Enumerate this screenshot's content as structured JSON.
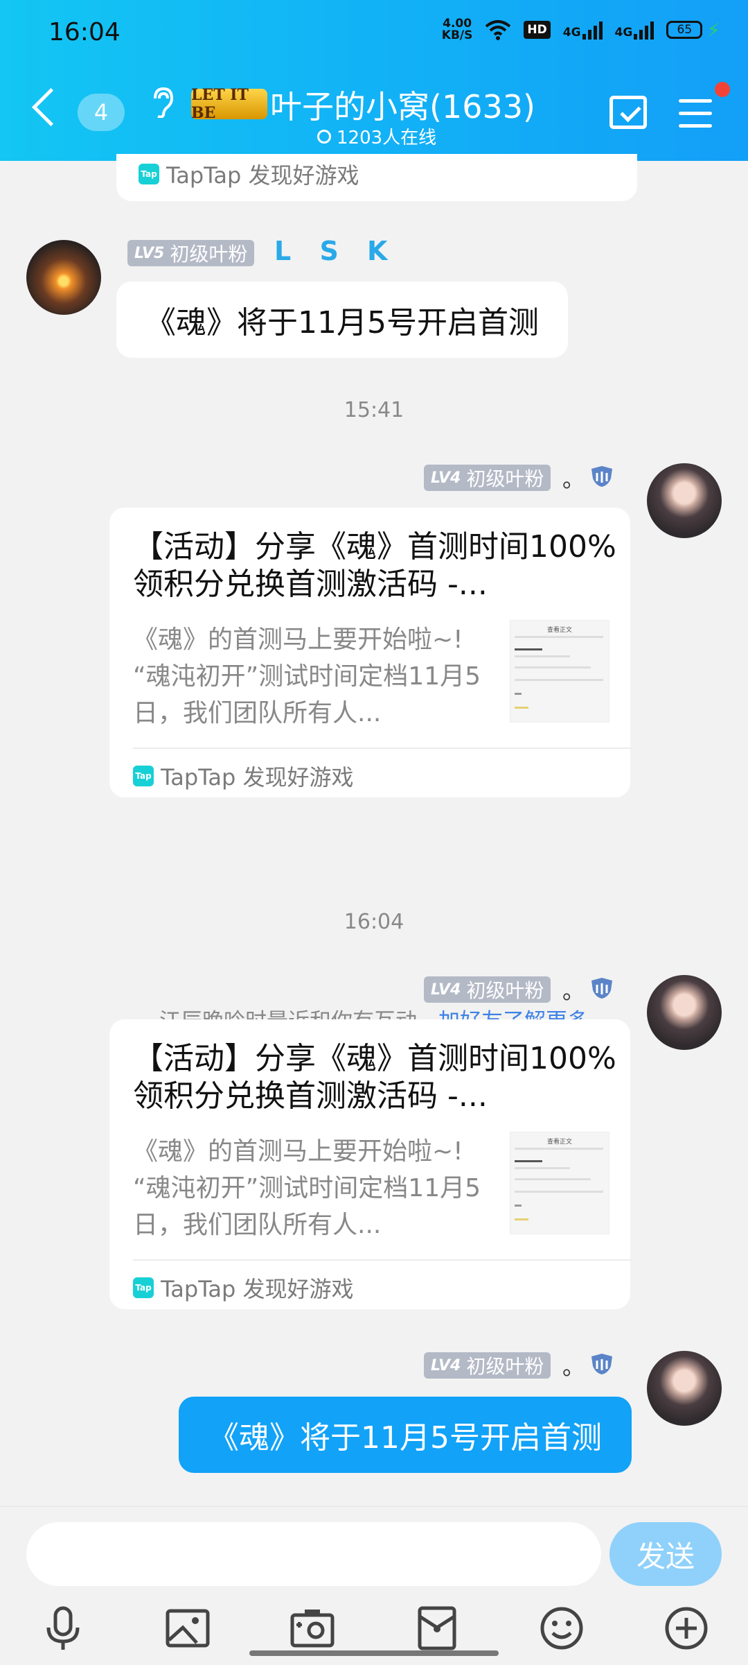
{
  "status_bar": {
    "time": "16:04",
    "net_speed_value": "4.00",
    "net_speed_unit": "KB/S",
    "hd_label": "HD",
    "sig1": "4G",
    "sig2": "4G",
    "battery": "65"
  },
  "header": {
    "unread_count": "4",
    "logo_text": "LET IT BE",
    "title": "叶子的小窝(1633)",
    "online": "1203人在线"
  },
  "messages": {
    "top_partial_source": "TapTap 发现好游戏",
    "msg1": {
      "level_badge": "LV5",
      "level_title": "初级叶粉",
      "username": "L S K",
      "text": "《魂》将于11月5号开启首测"
    },
    "time1": "15:41",
    "msg2": {
      "level_badge": "LV4",
      "level_title": "初级叶粉",
      "suffix": "。",
      "card_title": "【活动】分享《魂》首测时间100%领积分兑换首测激活码 -...",
      "card_body": "《魂》的首测马上要开始啦~! “魂沌初开”测试时间定档11月5日，我们团队所有人...",
      "thumb_title": "查看正文",
      "source": "TapTap 发现好游戏"
    },
    "notice_text": "江辰晚吟时最近和你有互动，",
    "notice_link": "加好友了解更多",
    "time2": "16:04",
    "msg3": {
      "level_badge": "LV4",
      "level_title": "初级叶粉",
      "suffix": "。",
      "card_title": "【活动】分享《魂》首测时间100%领积分兑换首测激活码 -...",
      "card_body": "《魂》的首测马上要开始啦~! “魂沌初开”测试时间定档11月5日，我们团队所有人...",
      "thumb_title": "查看正文",
      "source": "TapTap 发现好游戏"
    },
    "msg4": {
      "level_badge": "LV4",
      "level_title": "初级叶粉",
      "suffix": "。",
      "text": "《魂》将于11月5号开启首测"
    }
  },
  "input_bar": {
    "placeholder": "",
    "send_label": "发送"
  },
  "icons": [
    "back-icon",
    "ear-icon",
    "calendar-check-icon",
    "menu-icon",
    "mic-icon",
    "image-icon",
    "camera-icon",
    "redpacket-icon",
    "emoji-icon",
    "plus-icon"
  ],
  "colors": {
    "header_start": "#13c6f3",
    "header_end": "#139ff7",
    "my_bubble": "#12a2f8",
    "link": "#3e82e5",
    "send_button": "#8fd1fb"
  }
}
